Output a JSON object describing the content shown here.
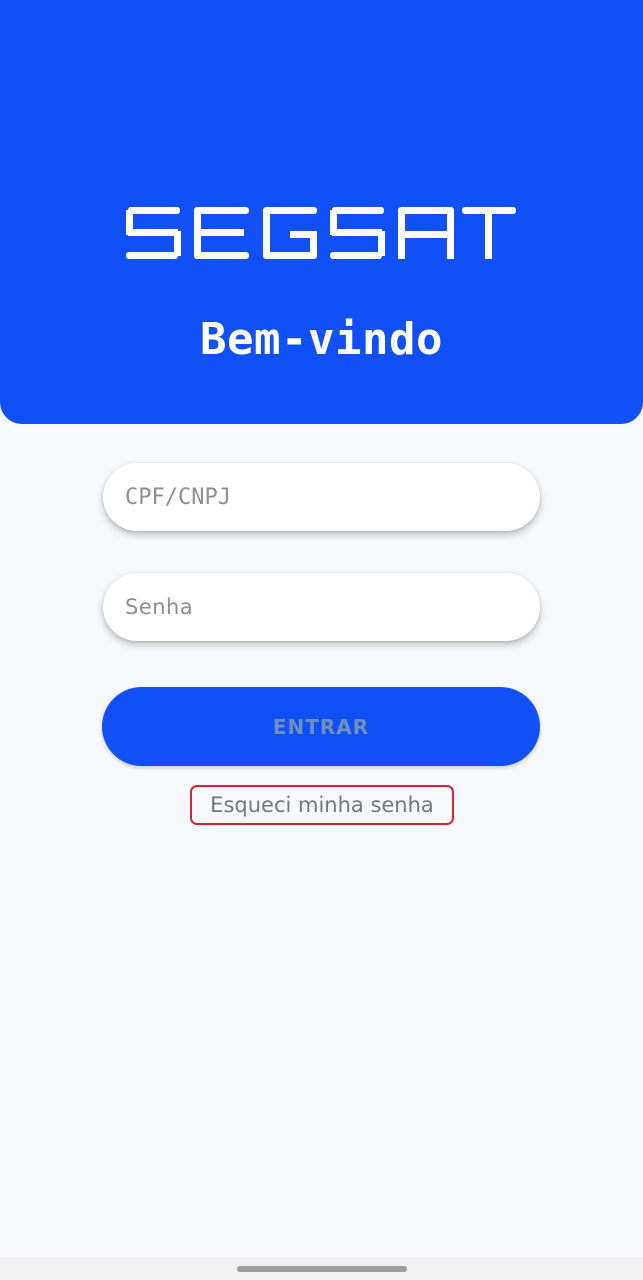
{
  "header": {
    "logo_text": "SEGSAT",
    "welcome": "Bem-vindo"
  },
  "form": {
    "cpf_placeholder": "CPF/CNPJ",
    "cpf_value": "",
    "senha_placeholder": "Senha",
    "senha_value": "",
    "submit_label": "ENTRAR",
    "forgot_label": "Esqueci minha senha"
  },
  "colors": {
    "brand_blue": "#1150f7",
    "background": "#f7f9fe",
    "highlight_border": "#d9232d"
  },
  "icons": {
    "logo": "segsat-logo",
    "nav_handle": "gesture-handle"
  }
}
